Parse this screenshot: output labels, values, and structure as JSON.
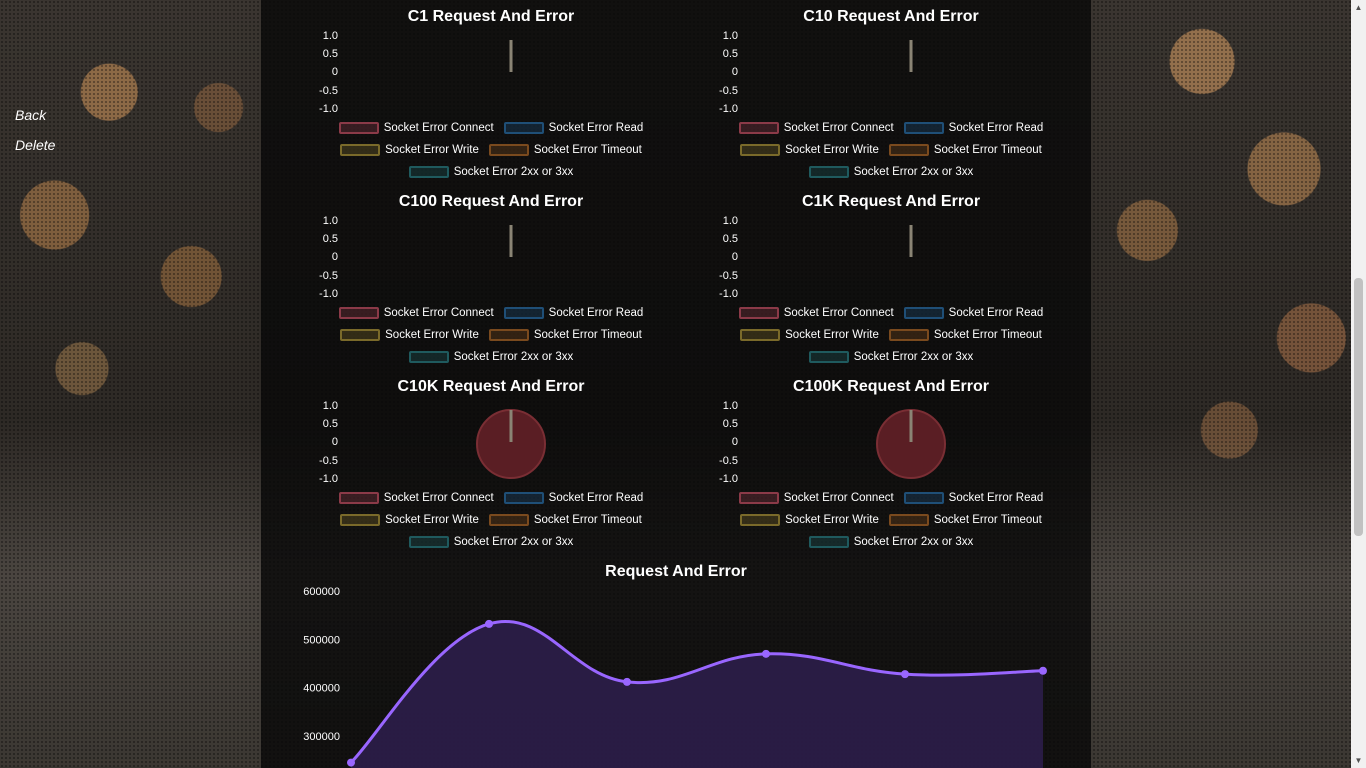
{
  "nav": {
    "back": "Back",
    "delete": "Delete"
  },
  "legend": {
    "connect": "Socket Error Connect",
    "read": "Socket Error Read",
    "write": "Socket Error Write",
    "timeout": "Socket Error Timeout",
    "non2xx": "Socket Error 2xx or 3xx"
  },
  "colors": {
    "connect": "#8b3a48",
    "read": "#1f4f77",
    "write": "#7a6a2a",
    "timeout": "#7a4a1e",
    "non2xx": "#1f5a5e",
    "gauge_fill": "#5a1e24",
    "gauge_border": "#7a2e34",
    "line": "#9966ff",
    "area": "#2e1f4d"
  },
  "yticks": [
    "1.0",
    "0.5",
    "0",
    "-0.5",
    "-1.0"
  ],
  "gauges": [
    {
      "title": "C1 Request And Error",
      "has_data": false
    },
    {
      "title": "C10 Request And Error",
      "has_data": false
    },
    {
      "title": "C100 Request And Error",
      "has_data": false
    },
    {
      "title": "C1K Request And Error",
      "has_data": false
    },
    {
      "title": "C10K Request And Error",
      "has_data": true
    },
    {
      "title": "C100K Request And Error",
      "has_data": true
    }
  ],
  "chart_data": {
    "type": "line",
    "title": "Request And Error",
    "yticks": [
      "600000",
      "500000",
      "400000",
      "300000"
    ],
    "ylim": [
      0,
      600000
    ],
    "values": [
      245000,
      532000,
      412000,
      470000,
      428000,
      435000
    ],
    "fill": true
  }
}
